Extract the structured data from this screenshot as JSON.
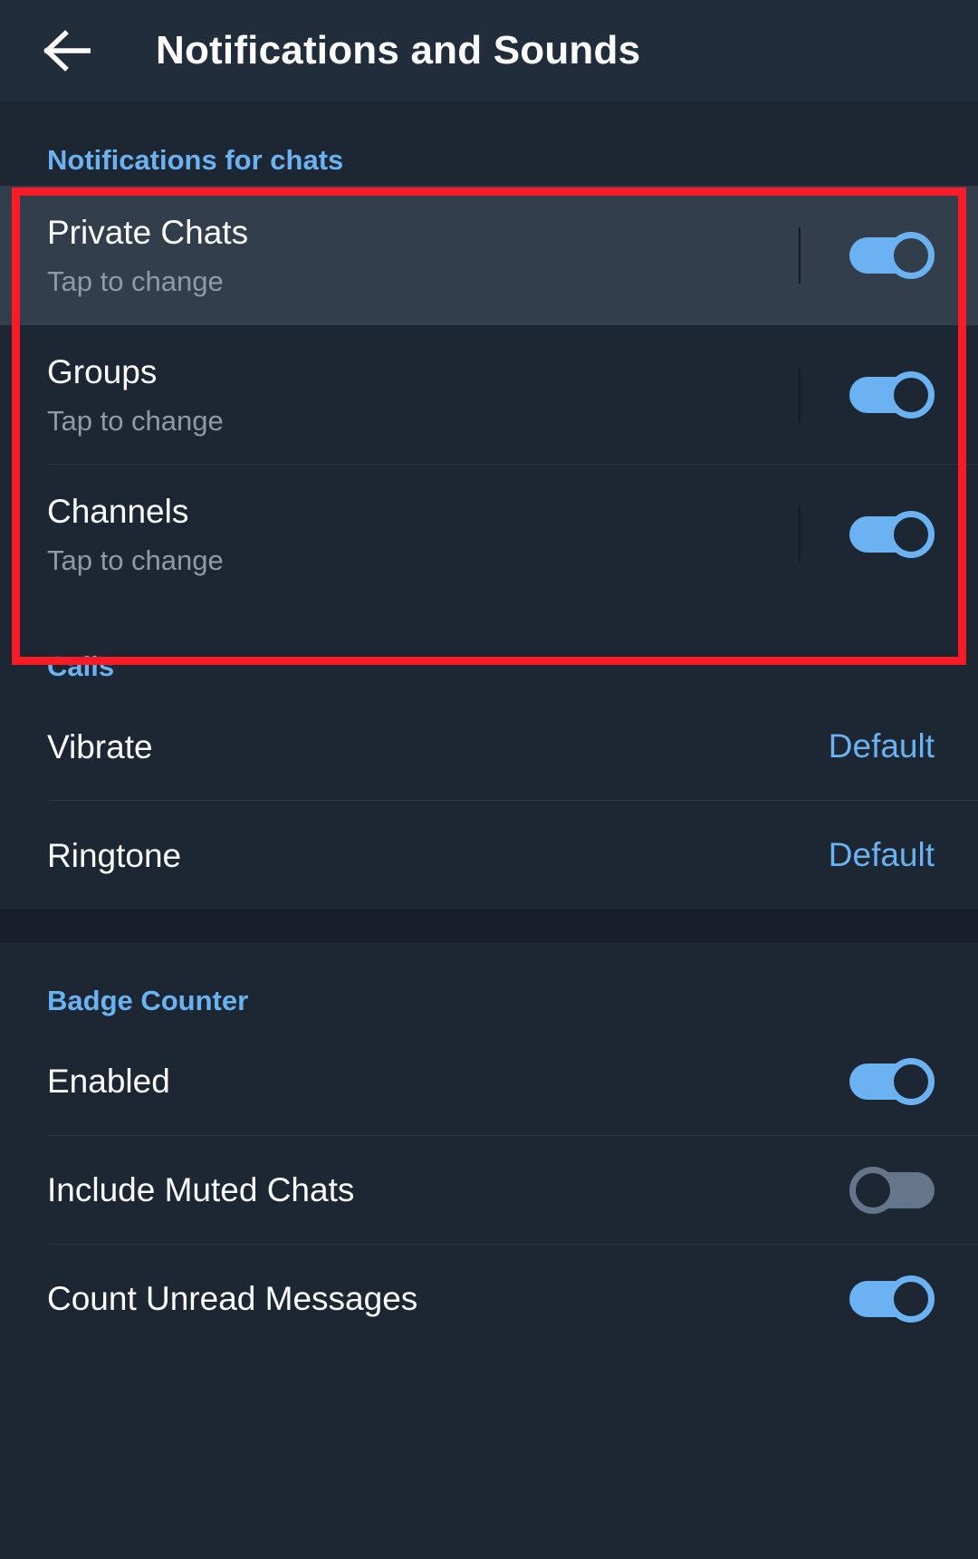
{
  "appbar": {
    "back_icon": "arrow-left-icon",
    "title": "Notifications and Sounds"
  },
  "colors": {
    "background": "#1d2733",
    "appbar_background": "#212d3b",
    "accent": "#6ab2f2",
    "row_highlight": "#333e4d",
    "title_text": "#ffffff",
    "subtitle_text": "#8e9aa8",
    "switch_on": "#6ab2f2",
    "switch_off": "#65758a",
    "annotation": "#fa1b26"
  },
  "sections": [
    {
      "header": "Notifications for chats",
      "rows": [
        {
          "title": "Private Chats",
          "subtitle": "Tap to change",
          "switch": "on",
          "highlighted": true
        },
        {
          "title": "Groups",
          "subtitle": "Tap to change",
          "switch": "on",
          "highlighted": false
        },
        {
          "title": "Channels",
          "subtitle": "Tap to change",
          "switch": "on",
          "highlighted": false
        }
      ]
    },
    {
      "header": "Calls",
      "rows": [
        {
          "title": "Vibrate",
          "value": "Default"
        },
        {
          "title": "Ringtone",
          "value": "Default"
        }
      ]
    },
    {
      "header": "Badge Counter",
      "rows": [
        {
          "title": "Enabled",
          "switch": "on"
        },
        {
          "title": "Include Muted Chats",
          "switch": "off"
        },
        {
          "title": "Count Unread Messages",
          "switch": "on"
        }
      ]
    }
  ]
}
